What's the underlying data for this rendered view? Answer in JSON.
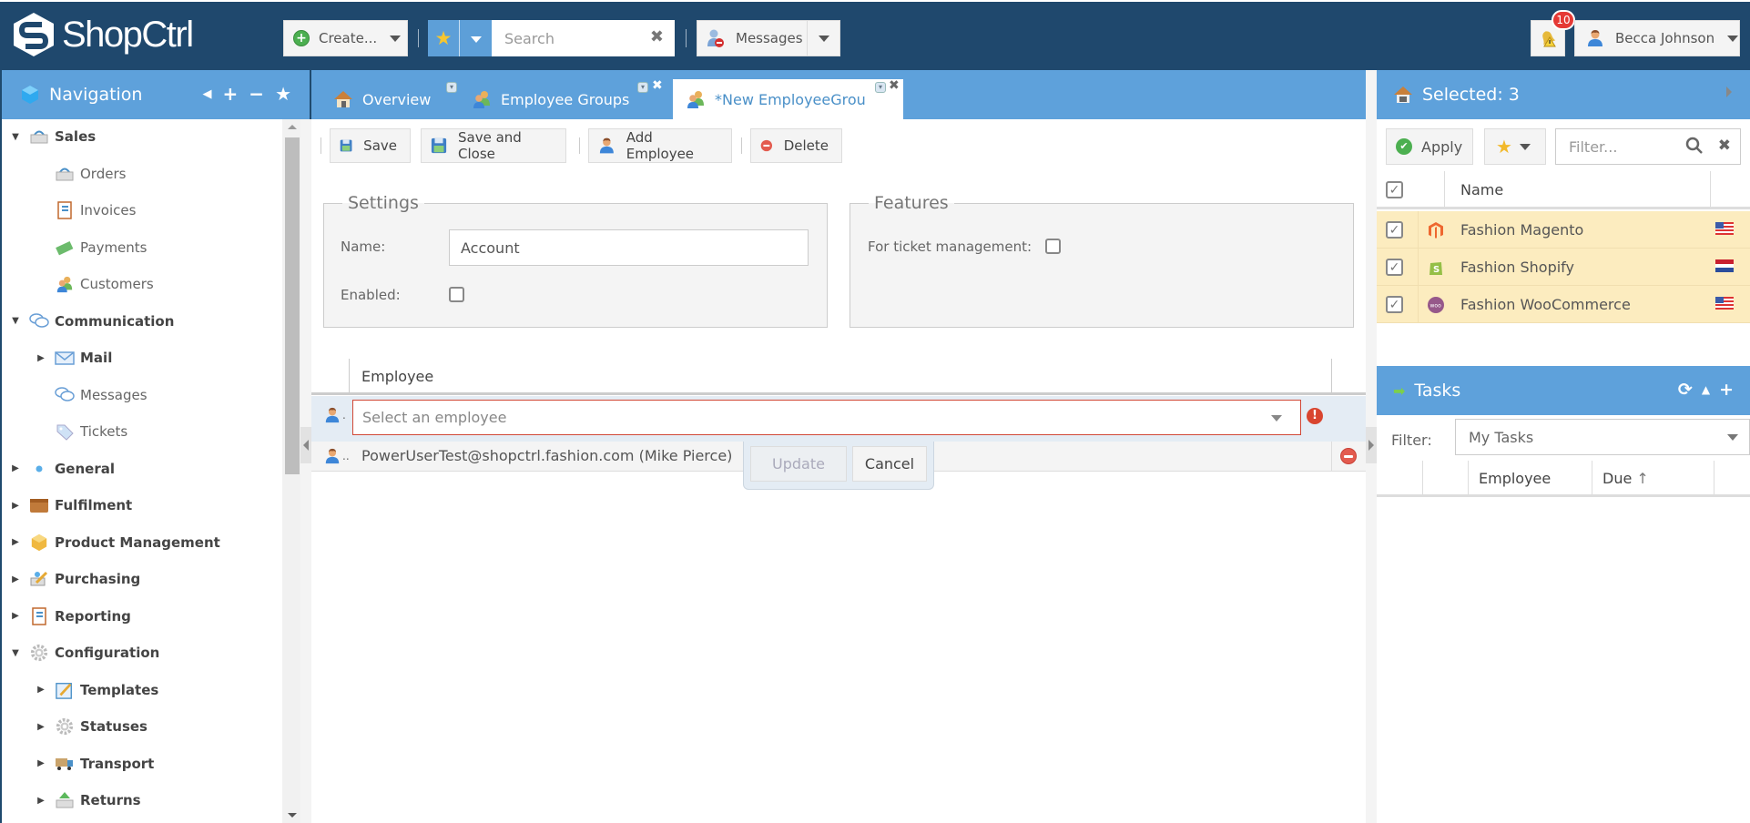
{
  "app": {
    "name": "ShopCtrl"
  },
  "topbar": {
    "create_label": "Create...",
    "search_placeholder": "Search",
    "messages_label": "Messages",
    "notifications_count": "10",
    "user_name": "Becca Johnson"
  },
  "navigation": {
    "title": "Navigation",
    "items": [
      {
        "label": "Sales",
        "level": 0,
        "expanded": true,
        "icon": "basket-icon"
      },
      {
        "label": "Orders",
        "level": 1,
        "icon": "basket-icon"
      },
      {
        "label": "Invoices",
        "level": 1,
        "icon": "notebook-icon"
      },
      {
        "label": "Payments",
        "level": 1,
        "icon": "money-icon"
      },
      {
        "label": "Customers",
        "level": 1,
        "icon": "users-icon"
      },
      {
        "label": "Communication",
        "level": 0,
        "expanded": true,
        "icon": "chat-icon"
      },
      {
        "label": "Mail",
        "level": 1,
        "expandable": true,
        "icon": "mail-icon"
      },
      {
        "label": "Messages",
        "level": 1,
        "icon": "chat-icon"
      },
      {
        "label": "Tickets",
        "level": 1,
        "icon": "tag-icon"
      },
      {
        "label": "General",
        "level": 0,
        "expandable": true,
        "icon": "dot-icon"
      },
      {
        "label": "Fulfilment",
        "level": 0,
        "expandable": true,
        "icon": "box-icon"
      },
      {
        "label": "Product Management",
        "level": 0,
        "expandable": true,
        "icon": "package-icon"
      },
      {
        "label": "Purchasing",
        "level": 0,
        "expandable": true,
        "icon": "purchase-icon"
      },
      {
        "label": "Reporting",
        "level": 0,
        "expandable": true,
        "icon": "notebook-icon"
      },
      {
        "label": "Configuration",
        "level": 0,
        "expanded": true,
        "icon": "gear-icon"
      },
      {
        "label": "Templates",
        "level": 1,
        "expandable": true,
        "icon": "pencil-icon"
      },
      {
        "label": "Statuses",
        "level": 1,
        "expandable": true,
        "icon": "gear-icon"
      },
      {
        "label": "Transport",
        "level": 1,
        "expandable": true,
        "icon": "truck-icon"
      },
      {
        "label": "Returns",
        "level": 1,
        "expandable": true,
        "icon": "return-icon"
      }
    ]
  },
  "tabs": [
    {
      "label": "Overview",
      "active": false
    },
    {
      "label": "Employee Groups",
      "active": false
    },
    {
      "label": "*New EmployeeGrou",
      "active": true
    }
  ],
  "toolbar": {
    "save": "Save",
    "save_close": "Save and Close",
    "add_employee": "Add Employee",
    "delete": "Delete"
  },
  "settings": {
    "legend": "Settings",
    "name_label": "Name:",
    "name_value": "Account",
    "enabled_label": "Enabled:",
    "enabled": false
  },
  "features": {
    "legend": "Features",
    "ticket_label": "For ticket management:",
    "ticket_enabled": false
  },
  "employee_grid": {
    "column": "Employee",
    "edit_placeholder": "Select an employee",
    "rows": [
      {
        "employee": "PowerUserTest@shopctrl.fashion.com (Mike Pierce)"
      }
    ],
    "update_label": "Update",
    "cancel_label": "Cancel"
  },
  "selected_panel": {
    "title": "Selected: 3",
    "apply_label": "Apply",
    "filter_placeholder": "Filter...",
    "name_header": "Name",
    "rows": [
      {
        "name": "Fashion Magento",
        "platform": "magento",
        "flag": "us",
        "checked": true
      },
      {
        "name": "Fashion Shopify",
        "platform": "shopify",
        "flag": "nl",
        "checked": true
      },
      {
        "name": "Fashion WooCommerce",
        "platform": "woocommerce",
        "flag": "us",
        "checked": true
      }
    ]
  },
  "tasks_panel": {
    "title": "Tasks",
    "filter_label": "Filter:",
    "filter_value": "My Tasks",
    "columns": [
      "",
      "Employee",
      "Due"
    ]
  },
  "colors": {
    "topbar": "#1f486d",
    "panel_header": "#5ea1db",
    "selected_row": "#fcecbf",
    "error": "#d14836"
  }
}
